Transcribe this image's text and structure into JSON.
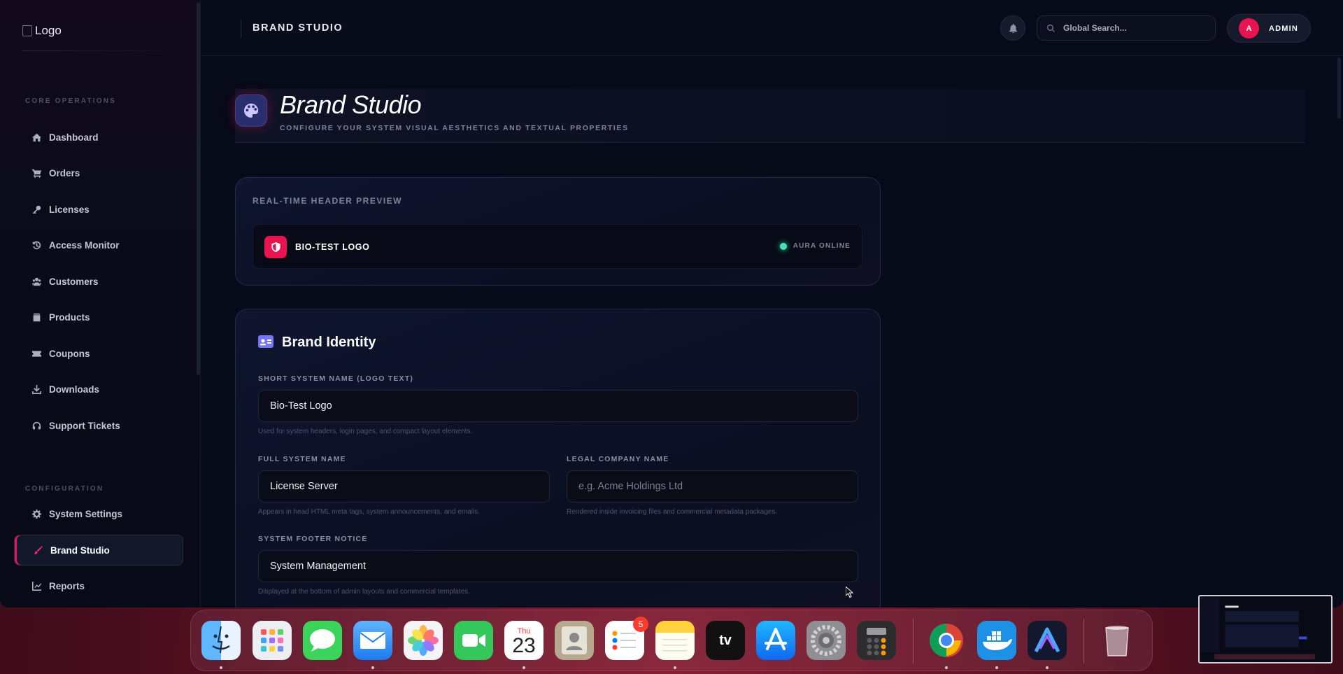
{
  "sidebar": {
    "logo_alt": "Logo",
    "section_core": "CORE OPERATIONS",
    "section_config": "CONFIGURATION",
    "core_items": [
      {
        "label": "Dashboard",
        "icon": "home-icon"
      },
      {
        "label": "Orders",
        "icon": "cart-icon"
      },
      {
        "label": "Licenses",
        "icon": "key-icon"
      },
      {
        "label": "Access Monitor",
        "icon": "history-icon"
      },
      {
        "label": "Customers",
        "icon": "users-icon"
      },
      {
        "label": "Products",
        "icon": "box-icon"
      },
      {
        "label": "Coupons",
        "icon": "ticket-icon"
      },
      {
        "label": "Downloads",
        "icon": "download-icon"
      },
      {
        "label": "Support Tickets",
        "icon": "headset-icon"
      }
    ],
    "config_items": [
      {
        "label": "System Settings",
        "icon": "gear-icon"
      },
      {
        "label": "Brand Studio",
        "icon": "brush-icon",
        "active": true
      },
      {
        "label": "Reports",
        "icon": "chart-line-icon"
      }
    ]
  },
  "topbar": {
    "title": "BRAND STUDIO",
    "search_placeholder": "Global Search...",
    "avatar_initial": "A",
    "user_label": "ADMIN"
  },
  "page": {
    "title": "Brand Studio",
    "subtitle": "CONFIGURE YOUR SYSTEM VISUAL AESTHETICS AND TEXTUAL PROPERTIES"
  },
  "preview": {
    "label": "REAL-TIME HEADER PREVIEW",
    "logo_text": "BIO-TEST LOGO",
    "status_text": "AURA ONLINE",
    "status_color": "#3ee6b0"
  },
  "identity": {
    "title": "Brand Identity",
    "short_name": {
      "label": "SHORT SYSTEM NAME (LOGO TEXT)",
      "value": "Bio-Test Logo",
      "help": "Used for system headers, login pages, and compact layout elements."
    },
    "full_name": {
      "label": "FULL SYSTEM NAME",
      "value": "License Server",
      "help": "Appears in head HTML meta tags, system announcements, and emails."
    },
    "legal_name": {
      "label": "LEGAL COMPANY NAME",
      "value": "",
      "placeholder": "e.g. Acme Holdings Ltd",
      "help": "Rendered inside invoicing files and commercial metadata packages."
    },
    "footer": {
      "label": "SYSTEM FOOTER NOTICE",
      "value": "System Management",
      "help": "Displayed at the bottom of admin layouts and commercial templates."
    }
  },
  "dock": {
    "calendar_day": "Thu",
    "calendar_date": "23",
    "reminders_badge": "5",
    "tv_label": "tv",
    "apps": [
      "Finder",
      "Launchpad",
      "Messages",
      "Mail",
      "Photos",
      "FaceTime",
      "Calendar",
      "Contacts",
      "Reminders",
      "Notes",
      "Apple TV",
      "App Store",
      "System Settings",
      "Calculator",
      "Chrome",
      "Docker",
      "Affinity",
      "Trash"
    ]
  },
  "colors": {
    "accent": "#e8134f",
    "active_nav_bg": "#121729",
    "background": "#070a18"
  }
}
